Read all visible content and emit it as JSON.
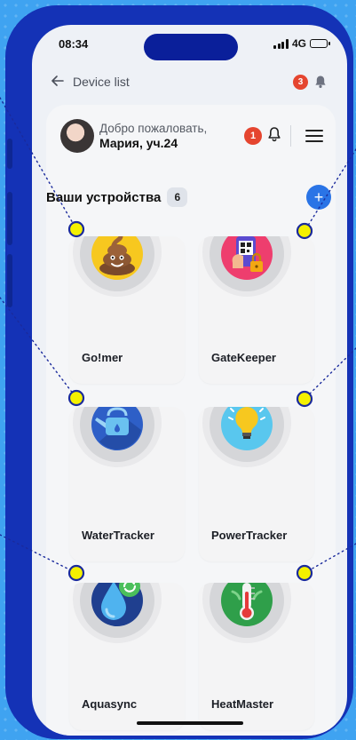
{
  "status_bar": {
    "time": "08:34",
    "network": "4G"
  },
  "top_nav": {
    "title": "Device list",
    "notification_count": "3"
  },
  "welcome": {
    "greeting": "Добро пожаловать,",
    "user_name": "Мария, уч.24",
    "notification_count": "1"
  },
  "devices_section": {
    "title": "Ваши устройства",
    "count": "6",
    "add_label": "+"
  },
  "devices": [
    {
      "name": "Go!mer",
      "icon": "poop-emoji-icon"
    },
    {
      "name": "GateKeeper",
      "icon": "qr-lock-phone-icon"
    },
    {
      "name": "WaterTracker",
      "icon": "watering-can-icon"
    },
    {
      "name": "PowerTracker",
      "icon": "lightbulb-icon"
    },
    {
      "name": "Aquasync",
      "icon": "water-drop-sync-icon"
    },
    {
      "name": "HeatMaster",
      "icon": "thermometer-icon"
    }
  ],
  "colors": {
    "background": "#3fa3f1",
    "phone_frame": "#1432b6",
    "accent_blue": "#2a74e6",
    "badge_red": "#e5452f",
    "guide_marker": "#f4f000"
  }
}
